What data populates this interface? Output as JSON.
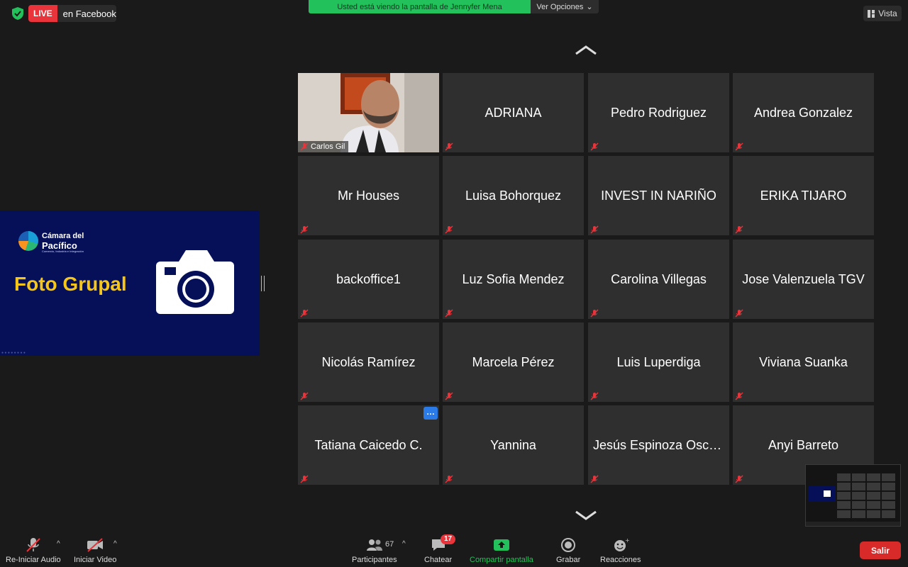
{
  "top_bar": {
    "live_label": "LIVE",
    "live_platform": "en Facebook",
    "share_banner": "Usted está viendo la pantalla de Jennyfer Mena",
    "view_options": "Ver Opciones",
    "view_button": "Vista"
  },
  "shared_screen": {
    "logo_line1": "Cámara del",
    "logo_line2": "Pacífico",
    "logo_sub": "Comercio, Industria e Integración",
    "title": "Foto Grupal"
  },
  "participants": [
    {
      "name": "Carlos Gil",
      "video": true
    },
    {
      "name": "ADRIANA"
    },
    {
      "name": "Pedro Rodriguez"
    },
    {
      "name": "Andrea Gonzalez"
    },
    {
      "name": "Mr Houses"
    },
    {
      "name": "Luisa Bohorquez"
    },
    {
      "name": "INVEST IN NARIÑO"
    },
    {
      "name": "ERIKA TIJARO"
    },
    {
      "name": "backoffice1"
    },
    {
      "name": "Luz Sofia Mendez"
    },
    {
      "name": "Carolina Villegas"
    },
    {
      "name": "Jose Valenzuela TGV"
    },
    {
      "name": "Nicolás Ramírez"
    },
    {
      "name": "Marcela Pérez"
    },
    {
      "name": "Luis Luperdiga"
    },
    {
      "name": "Viviana Suanka"
    },
    {
      "name": "Tatiana Caicedo C."
    },
    {
      "name": "Yannina"
    },
    {
      "name": "Jesús Espinoza Osca..."
    },
    {
      "name": "Anyi Barreto"
    }
  ],
  "toolbar": {
    "audio_label": "Re-Iniciar Audio",
    "video_label": "Iniciar Video",
    "participants_label": "Participantes",
    "participants_count": "67",
    "chat_label": "Chatear",
    "chat_badge": "17",
    "share_label": "Compartir pantalla",
    "record_label": "Grabar",
    "reactions_label": "Reacciones",
    "leave_label": "Salir"
  },
  "colors": {
    "share_green": "#23c15b",
    "live_red": "#e8343a",
    "leave_red": "#d92a2a",
    "tile_bg": "#2f2f2f",
    "slide_blue": "#061059",
    "slide_title_yellow": "#f5c518"
  }
}
